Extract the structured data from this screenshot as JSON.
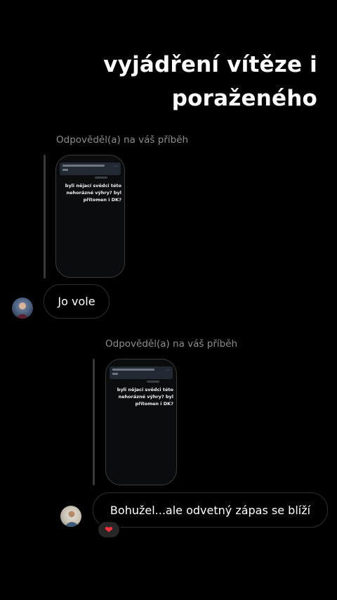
{
  "headline": {
    "line1": "vyjádření vítěze i",
    "line2": "poraženého"
  },
  "thread": [
    {
      "reply_label": "Odpověděl(a) na váš příběh",
      "story_text": "byli nějací svědci této nehorázné výhry? byl přítomen i DK?",
      "message": "Jo vole"
    },
    {
      "reply_label": "Odpověděl(a) na váš příběh",
      "story_text": "byli nějací svědci této nehorázné výhry? byl přítomen i DK?",
      "message": "Bohužel...ale odvetný zápas se blíží",
      "reaction": "❤"
    }
  ],
  "colors": {
    "background": "#000000",
    "muted_text": "#8e8e8e",
    "reaction_heart": "#ff3040"
  },
  "icons": {
    "avatar_1": "profile-photo-avatar",
    "avatar_2": "profile-photo-avatar",
    "reaction": "red-heart-icon"
  }
}
